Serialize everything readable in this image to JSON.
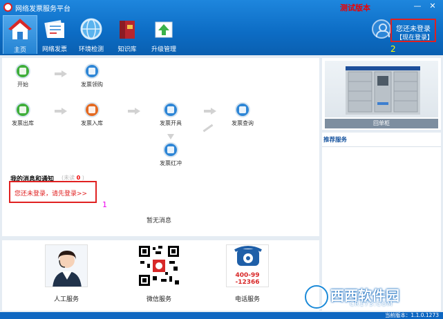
{
  "app": {
    "title": "网络发票服务平台",
    "test_badge": "测试版本",
    "minimize": "—",
    "close": "✕"
  },
  "nav": {
    "items": [
      {
        "label": "主页",
        "icon": "home-icon",
        "active": true
      },
      {
        "label": "网络发票",
        "icon": "invoice-icon"
      },
      {
        "label": "环境检测",
        "icon": "globe-icon"
      },
      {
        "label": "知识库",
        "icon": "books-icon"
      },
      {
        "label": "升级管理",
        "icon": "upgrade-icon"
      }
    ]
  },
  "user": {
    "status": "您还未登录",
    "login_link": "【现在登录】",
    "annotation": "2"
  },
  "flow": {
    "start": "开始",
    "receive": "发票领购",
    "out": "发票出库",
    "in": "发票入库",
    "issue": "发票开具",
    "query": "发票查询",
    "red": "发票红冲"
  },
  "messages": {
    "title": "我的消息和通知",
    "unread_label": "(未读",
    "unread_count": "0",
    "unread_close": ")",
    "login_tip": "您还未登录，请先登录>>",
    "annotation": "1",
    "empty": "暂无消息"
  },
  "services": [
    {
      "label": "人工服务",
      "icon": "customer-service-icon"
    },
    {
      "label": "微信服务",
      "icon": "qr-code-icon"
    },
    {
      "label": "电话服务",
      "icon": "phone-icon",
      "phone_line1": "400-99",
      "phone_line2": "-12366"
    }
  ],
  "right": {
    "cabinet_label": "回单柜",
    "recommend_title": "推荐服务"
  },
  "watermark": {
    "brand": "西西软件园",
    "url": "CR173.COM"
  },
  "status": {
    "version": "当前版本：1.1.0.1273"
  },
  "colors": {
    "header": "#0c6cc4",
    "highlight": "#e02020"
  }
}
